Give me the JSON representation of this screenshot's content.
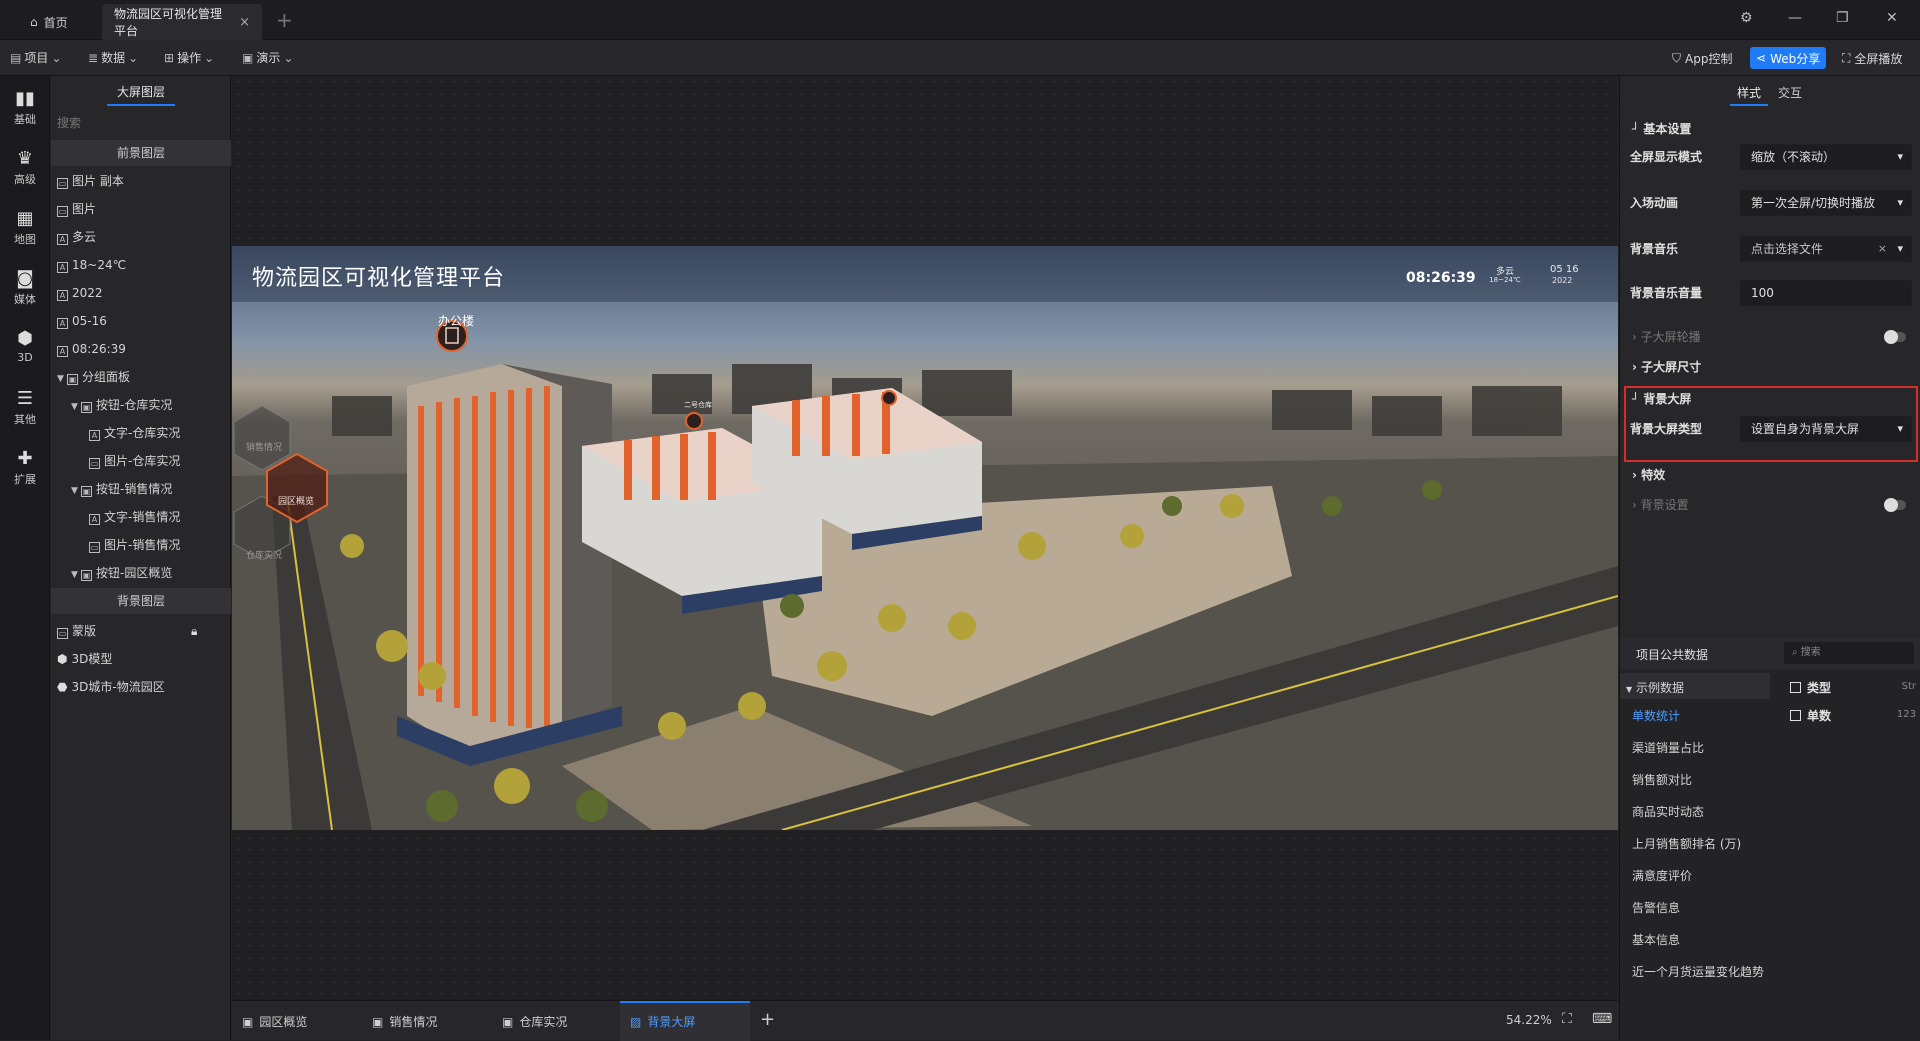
{
  "titlebar": {
    "home_tab": "首页",
    "active_tab": "物流园区可视化管理平台",
    "close_glyph": "×",
    "add_glyph": "+"
  },
  "toolbar": {
    "menus": [
      "项目",
      "数据",
      "操作",
      "演示"
    ],
    "app_control": "App控制",
    "web_share": "Web分享",
    "fullscreen": "全屏播放"
  },
  "rail": [
    "基础",
    "高级",
    "地图",
    "媒体",
    "3D",
    "其他",
    "扩展"
  ],
  "layers": {
    "title": "大屏图层",
    "search_placeholder": "搜索",
    "foreground_title": "前景图层",
    "foreground": [
      {
        "label": "图片 副本",
        "type": "image"
      },
      {
        "label": "图片",
        "type": "image"
      },
      {
        "label": "多云",
        "type": "text"
      },
      {
        "label": "18~24℃",
        "type": "text"
      },
      {
        "label": "2022",
        "type": "text"
      },
      {
        "label": "05-16",
        "type": "text"
      },
      {
        "label": "08:26:39",
        "type": "text"
      },
      {
        "label": "分组面板",
        "type": "group"
      },
      {
        "label": "按钮-仓库实况",
        "type": "group"
      },
      {
        "label": "文字-仓库实况",
        "type": "text"
      },
      {
        "label": "图片-仓库实况",
        "type": "image"
      },
      {
        "label": "按钮-销售情况",
        "type": "group"
      },
      {
        "label": "文字-销售情况",
        "type": "text"
      },
      {
        "label": "图片-销售情况",
        "type": "image"
      },
      {
        "label": "按钮-园区概览",
        "type": "group"
      }
    ],
    "background_title": "背景图层",
    "background": [
      {
        "label": "蒙版",
        "type": "image"
      },
      {
        "label": "3D模型",
        "type": "3d"
      },
      {
        "label": "3D城市-物流园区",
        "type": "city"
      }
    ]
  },
  "screen": {
    "title": "物流园区可视化管理平台",
    "time": "08:26:39",
    "weather": "多云",
    "temp": "18~24℃",
    "date_md": "05 16",
    "year": "2022",
    "office_label": "办公楼",
    "nav_buttons": [
      "销售情况",
      "园区概览",
      "仓库实况"
    ],
    "warehouse_tag": "二号仓库"
  },
  "props": {
    "tabs": [
      "样式",
      "交互"
    ],
    "basic_settings": "基本设置",
    "fullscreen_mode_label": "全屏显示模式",
    "fullscreen_mode_value": "缩放（不滚动）",
    "entry_anim_label": "入场动画",
    "entry_anim_value": "第一次全屏/切换时播放",
    "bg_music_label": "背景音乐",
    "bg_music_value": "点击选择文件",
    "bg_volume_label": "背景音乐音量",
    "bg_volume_value": "100",
    "sub_carousel": "子大屏轮播",
    "sub_size": "子大屏尺寸",
    "bg_screen": "背景大屏",
    "bg_screen_type_label": "背景大屏类型",
    "bg_screen_type_value": "设置自身为背景大屏",
    "effects": "特效",
    "bg_settings": "背景设置"
  },
  "datapanel": {
    "title": "项目公共数据",
    "search_placeholder": "搜索",
    "group": "示例数据",
    "items": [
      "单数统计",
      "渠道销量占比",
      "销售额对比",
      "商品实时动态",
      "上月销售额排名 (万)",
      "满意度评价",
      "告警信息",
      "基本信息",
      "近一个月货运量变化趋势"
    ],
    "fields": [
      {
        "name": "类型",
        "type": "Str"
      },
      {
        "name": "单数",
        "type": "123"
      }
    ]
  },
  "bottombar": {
    "tabs": [
      "园区概览",
      "销售情况",
      "仓库实况",
      "背景大屏"
    ],
    "add_glyph": "+",
    "zoom": "54.22%"
  },
  "colors": {
    "accent": "#1f7cf6",
    "highlight": "#d52c2c",
    "building_orange": "#e2622b"
  }
}
